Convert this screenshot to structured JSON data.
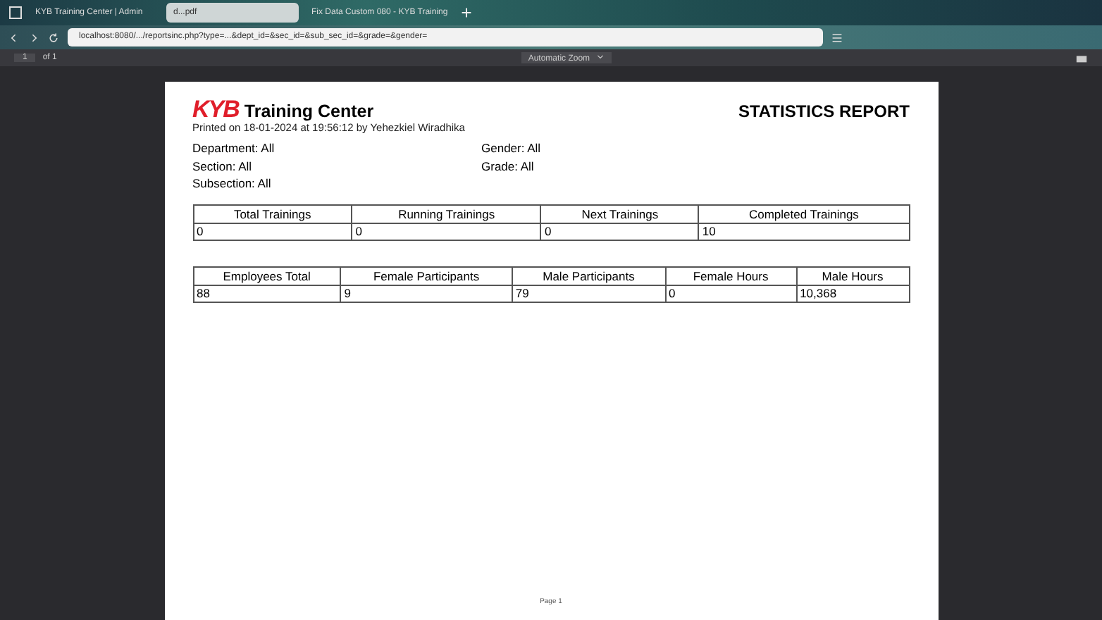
{
  "browser": {
    "tabs": [
      {
        "title": "KYB Training Center | Admin",
        "selected": false
      },
      {
        "title": "d...pdf",
        "selected": true
      },
      {
        "title": "Fix Data Custom 080 - KYB Training",
        "selected": false
      }
    ],
    "url": "localhost:8080/.../reportsinc.php?type=...&dept_id=&sec_id=&sub_sec_id=&grade=&gender="
  },
  "viewer": {
    "page_number": "1",
    "page_count": "of 1",
    "zoom": "Automatic Zoom"
  },
  "report": {
    "logo": "KYB",
    "org": "Training Center",
    "title": "STATISTICS REPORT",
    "printed": "Printed on 18-01-2024 at 19:56:12 by Yehezkiel Wiradhika",
    "filters": [
      [
        "Department: All",
        "Gender: All"
      ],
      [
        "Section: All",
        "Grade: All"
      ],
      [
        "Subsection: All"
      ]
    ],
    "tables": [
      {
        "columns": [
          "Total Trainings",
          "Running Trainings",
          "Next Trainings",
          "Completed Trainings"
        ],
        "rows": [
          [
            "0",
            "0",
            "0",
            "10"
          ]
        ]
      },
      {
        "columns": [
          "Employees Total",
          "Female Participants",
          "Male Participants",
          "Female Hours",
          "Male Hours"
        ],
        "rows": [
          [
            "88",
            "9",
            "79",
            "0",
            "10,368"
          ]
        ]
      }
    ],
    "footer": "Page 1"
  }
}
